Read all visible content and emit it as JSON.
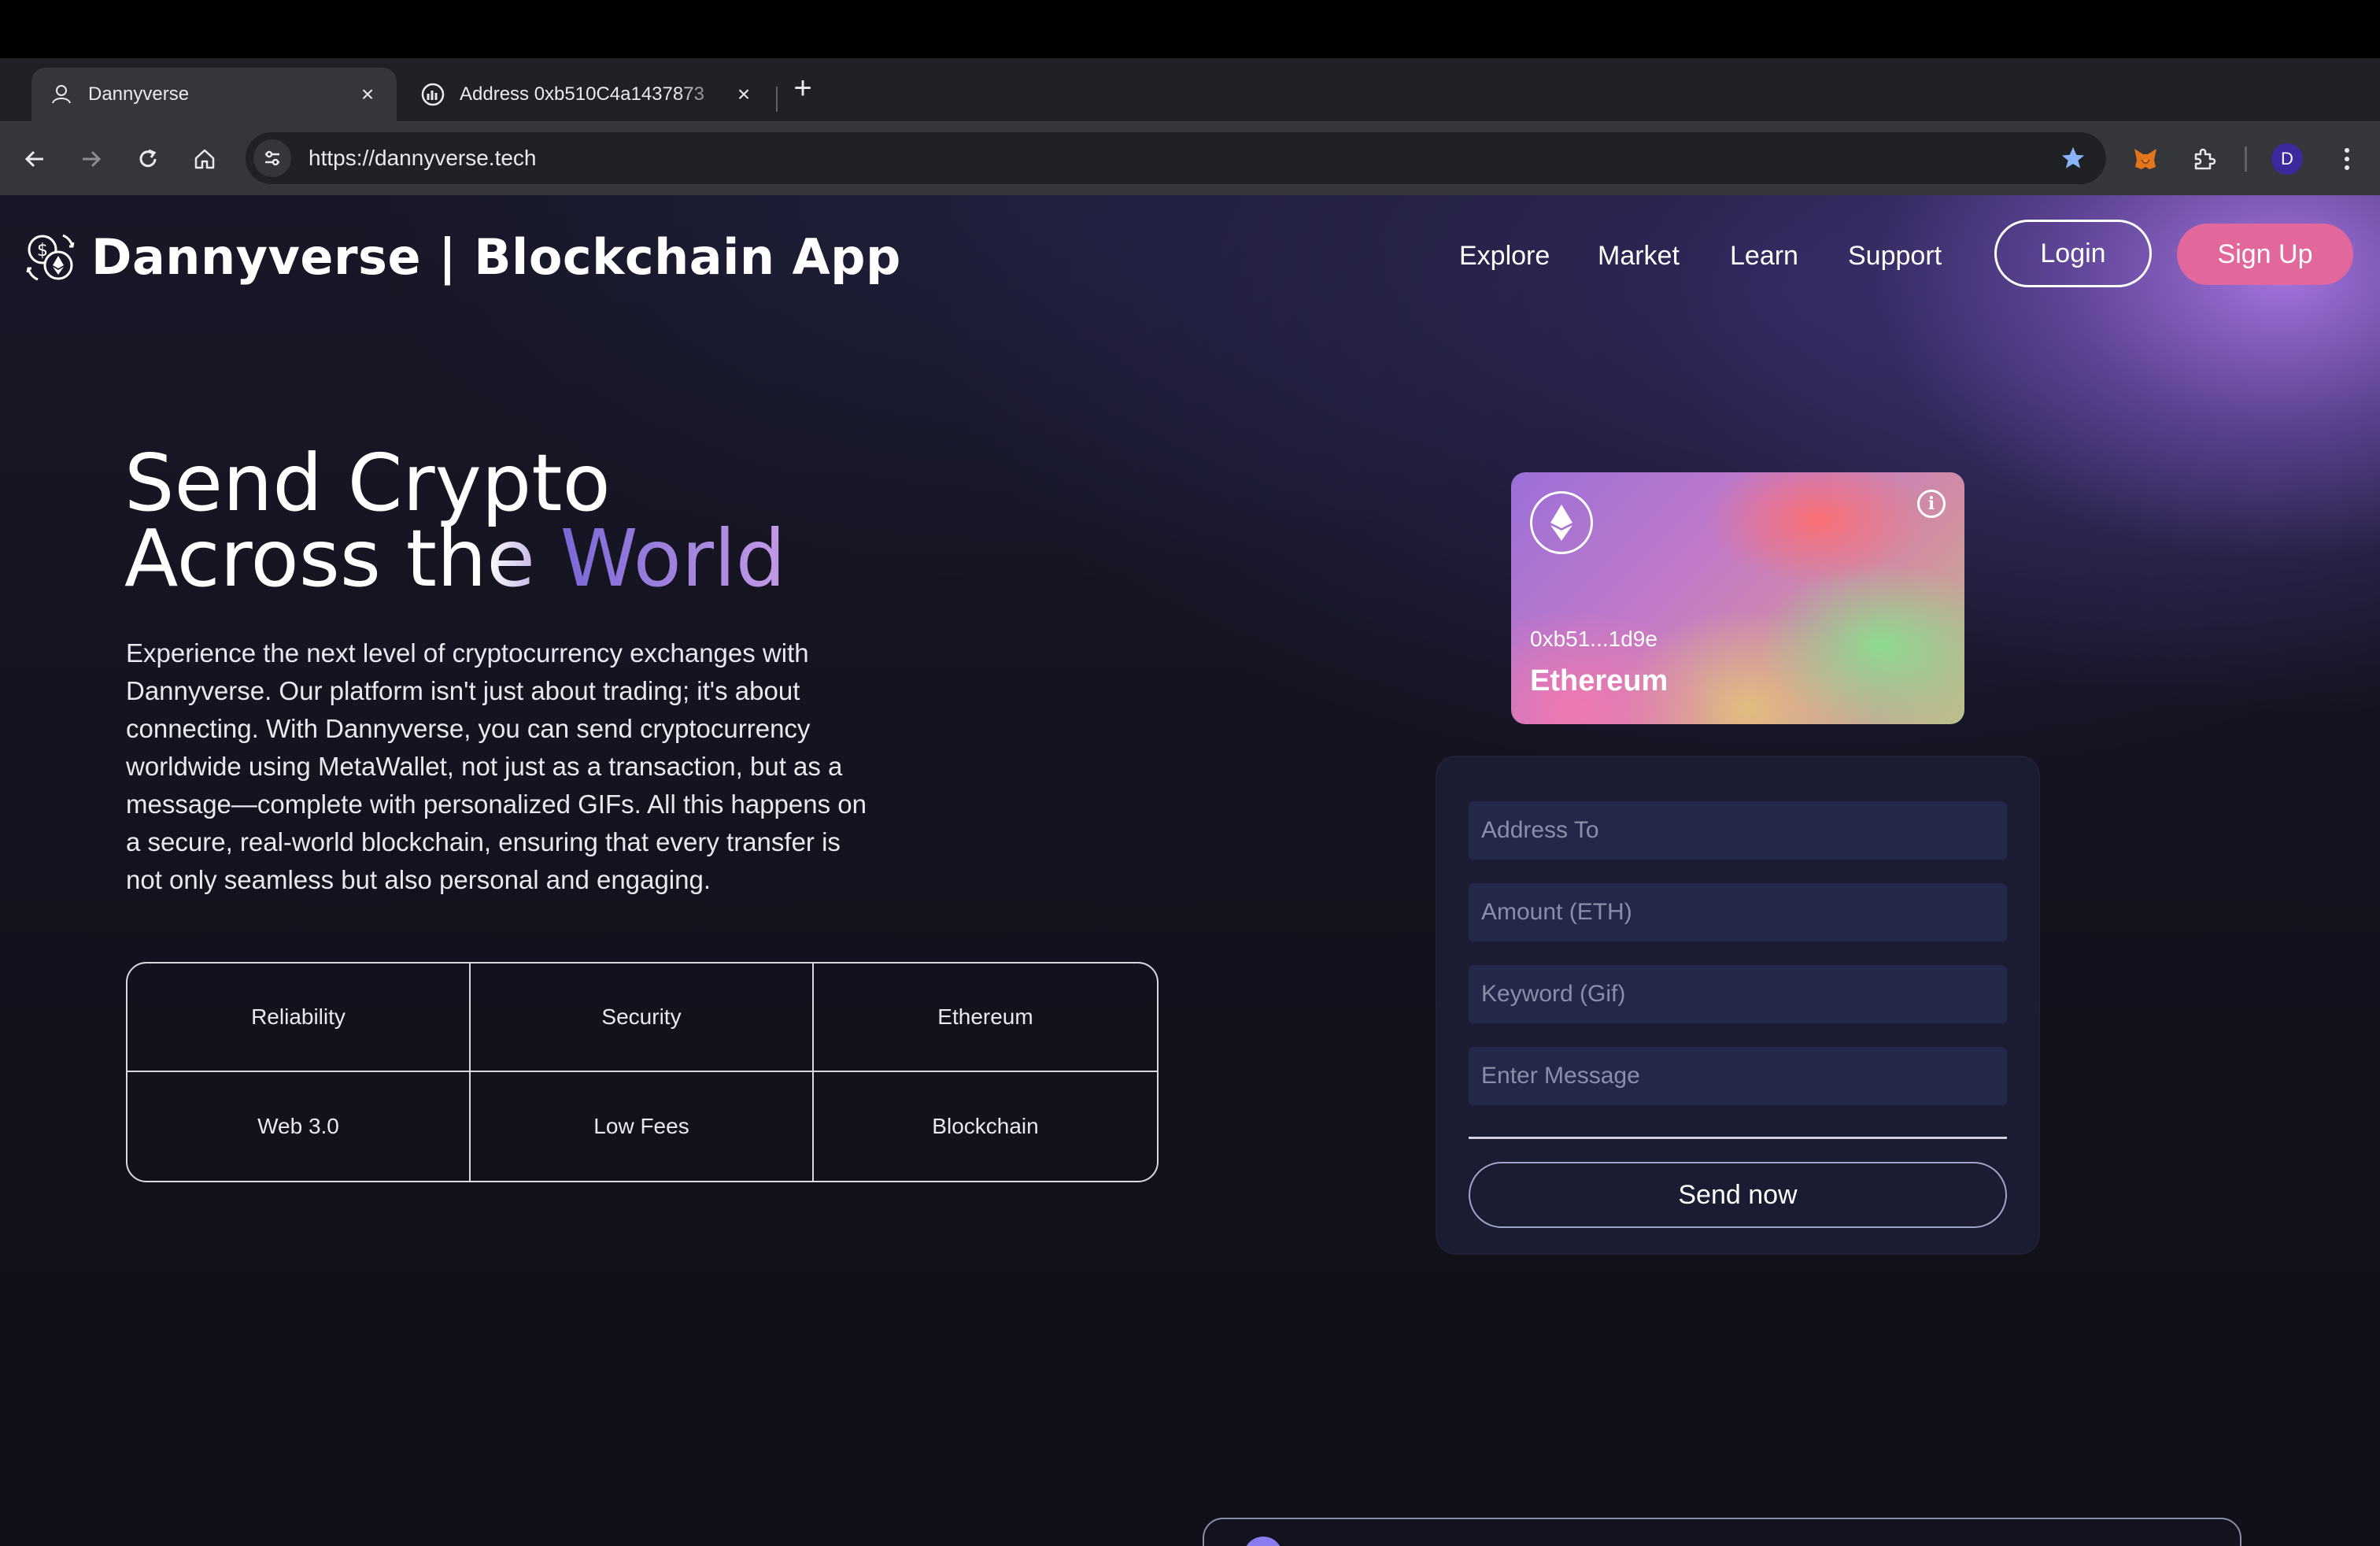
{
  "browser": {
    "tabs": [
      {
        "title": "Dannyverse",
        "icon": "dannyverse-favicon",
        "active": true
      },
      {
        "title": "Address 0xb510C4a1437873",
        "icon": "etherscan-favicon",
        "active": false
      }
    ],
    "url": "https://dannyverse.tech",
    "profile_initial": "D"
  },
  "site": {
    "brand": "Dannyverse | Blockchain App",
    "nav": [
      "Explore",
      "Market",
      "Learn",
      "Support"
    ],
    "login_label": "Login",
    "signup_label": "Sign Up"
  },
  "hero": {
    "title_line1": "Send Crypto",
    "title_line2_a": "Across t",
    "title_line2_b": "he ",
    "title_line2_c": "World",
    "description": "Experience the next level of cryptocurrency exchanges with Dannyverse. Our platform isn't just about trading; it's about connecting. With Dannyverse, you can send cryptocurrency worldwide using MetaWallet, not just as a transaction, but as a message—complete with personalized GIFs. All this happens on a secure, real-world blockchain, ensuring that every transfer is not only seamless but also personal and engaging."
  },
  "features": [
    "Reliability",
    "Security",
    "Ethereum",
    "Web 3.0",
    "Low Fees",
    "Blockchain"
  ],
  "card": {
    "address": "0xb51...1d9e",
    "network": "Ethereum",
    "info_glyph": "i"
  },
  "form": {
    "address_placeholder": "Address To",
    "amount_placeholder": "Amount (ETH)",
    "keyword_placeholder": "Keyword (Gif)",
    "message_placeholder": "Enter Message",
    "send_label": "Send now"
  },
  "colors": {
    "accent": "#e2679c",
    "purple": "#a790d8",
    "background": "#13131f"
  }
}
